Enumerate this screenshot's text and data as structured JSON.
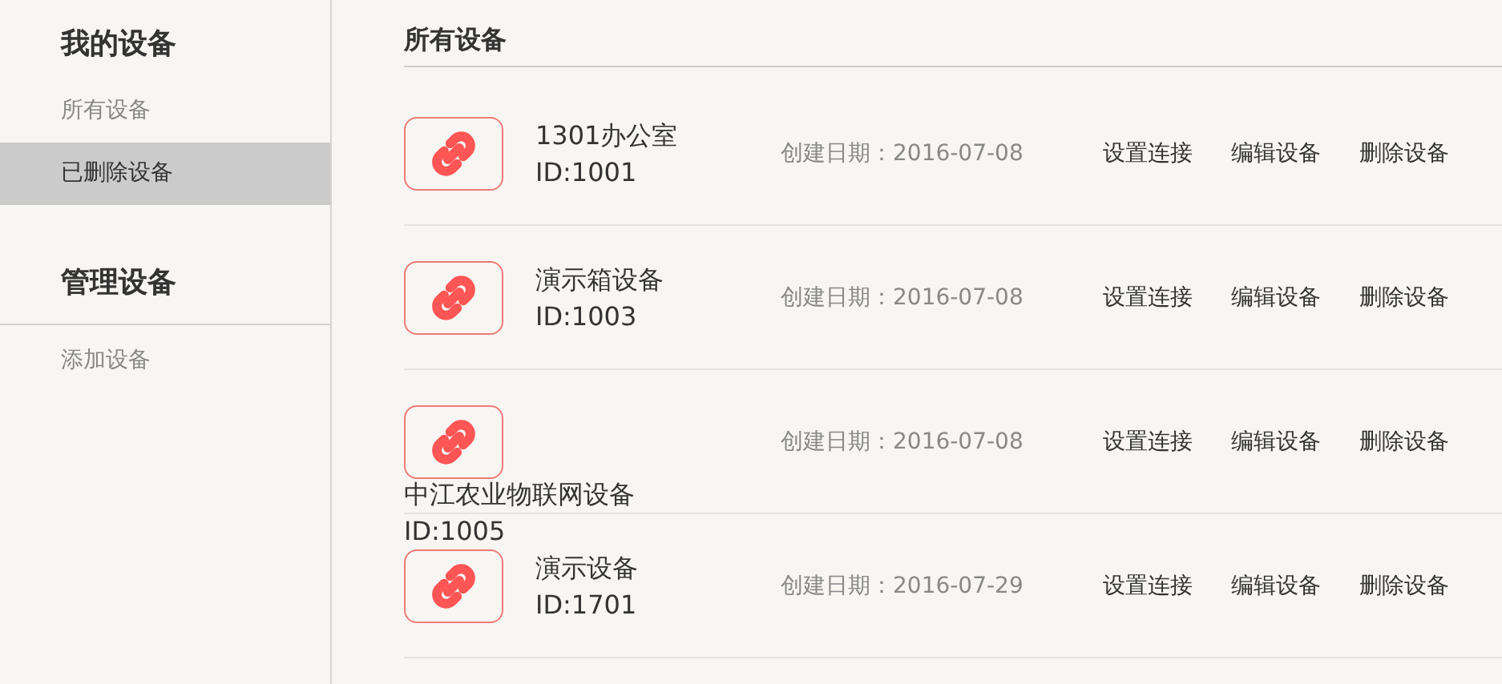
{
  "sidebar": {
    "sections": [
      {
        "title": "我的设备",
        "items": [
          {
            "label": "所有设备",
            "selected": false
          },
          {
            "label": "已删除设备",
            "selected": true
          }
        ]
      },
      {
        "title": "管理设备",
        "items": [
          {
            "label": "添加设备",
            "selected": false
          }
        ]
      }
    ]
  },
  "main": {
    "title": "所有设备",
    "devices": [
      {
        "name": "1301办公室",
        "id": "ID:1001",
        "date": "创建日期：2016-07-08",
        "actions": [
          "设置连接",
          "编辑设备",
          "删除设备"
        ],
        "kind": "inline"
      },
      {
        "name": "演示箱设备",
        "id": "ID:1003",
        "date": "创建日期：2016-07-08",
        "actions": [
          "设置连接",
          "编辑设备",
          "删除设备"
        ],
        "kind": "inline"
      },
      {
        "name": "中江农业物联网设备",
        "id": "ID:1005",
        "date": "创建日期：2016-07-08",
        "actions": [
          "设置连接",
          "编辑设备",
          "删除设备"
        ],
        "kind": "overflow"
      },
      {
        "name": "演示设备",
        "id": "ID:1701",
        "date": "创建日期：2016-07-29",
        "actions": [
          "设置连接",
          "编辑设备",
          "删除设备"
        ],
        "kind": "inline"
      }
    ]
  }
}
